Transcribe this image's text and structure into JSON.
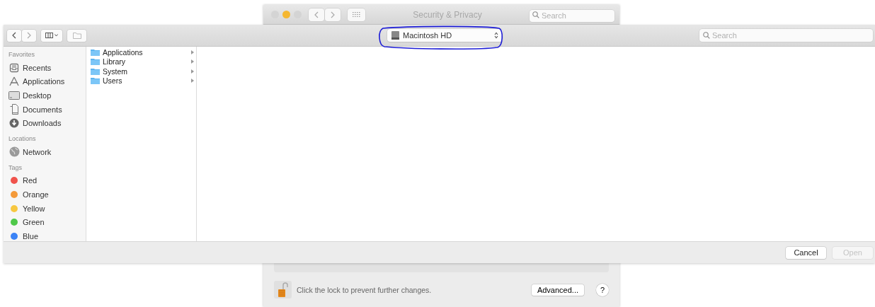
{
  "background_window": {
    "title": "Security & Privacy",
    "traffic_lights": [
      {
        "color": "#d4d4d4"
      },
      {
        "color": "#f5b731"
      },
      {
        "color": "#d4d4d4"
      }
    ],
    "search": {
      "placeholder": "Search"
    },
    "lock_message": "Click the lock to prevent further changes.",
    "advanced_button": "Advanced...",
    "help_button": "?"
  },
  "open_dialog": {
    "location": "Macintosh HD",
    "search": {
      "placeholder": "Search"
    },
    "sidebar": {
      "sections": [
        {
          "heading": "Favorites",
          "items": [
            {
              "label": "Recents"
            },
            {
              "label": "Applications"
            },
            {
              "label": "Desktop"
            },
            {
              "label": "Documents"
            },
            {
              "label": "Downloads"
            }
          ]
        },
        {
          "heading": "Locations",
          "items": [
            {
              "label": "Network"
            }
          ]
        },
        {
          "heading": "Tags",
          "items": [
            {
              "label": "Red",
              "color": "#f0534c"
            },
            {
              "label": "Orange",
              "color": "#f49a3a"
            },
            {
              "label": "Yellow",
              "color": "#f7c740"
            },
            {
              "label": "Green",
              "color": "#4fc849"
            },
            {
              "label": "Blue",
              "color": "#3b83f6"
            }
          ]
        }
      ]
    },
    "column": [
      {
        "label": "Applications"
      },
      {
        "label": "Library"
      },
      {
        "label": "System"
      },
      {
        "label": "Users"
      }
    ],
    "buttons": [
      {
        "label": "Cancel",
        "disabled": false
      },
      {
        "label": "Open",
        "disabled": true
      }
    ]
  },
  "annotation": {
    "color": "#1d1dd6"
  }
}
